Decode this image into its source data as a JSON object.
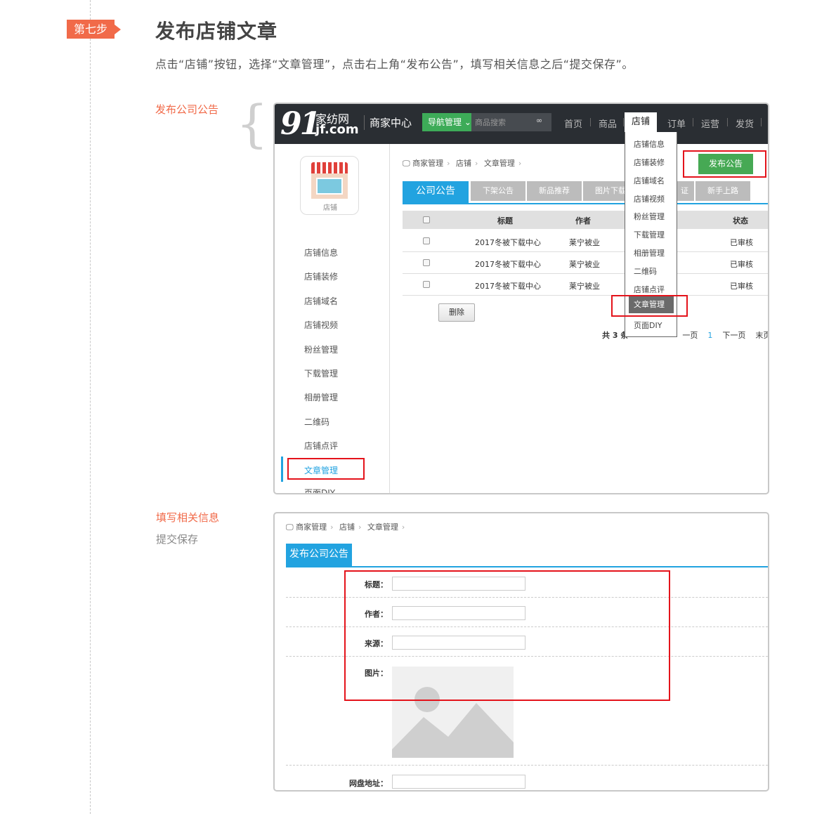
{
  "step": {
    "badge": "第七步",
    "title": "发布店铺文章",
    "instruction": "点击“店铺”按钮，选择“文章管理”，点击右上角“发布公告”，填写相关信息之后“提交保存”。"
  },
  "section1": {
    "label": "发布公司公告"
  },
  "section2": {
    "label": "填写相关信息",
    "sub_label": "提交保存"
  },
  "header": {
    "logo_num": "91",
    "logo_cn": "家纺网",
    "logo_en": "jf.com",
    "merchant_center": "商家中心",
    "nav_manage": "导航管理",
    "search_placeholder": "商品搜索",
    "nav": [
      "首页",
      "商品",
      "店铺",
      "订单",
      "运营",
      "发货"
    ]
  },
  "sidebar": {
    "shop_label": "店铺",
    "items": [
      "店铺信息",
      "店铺装修",
      "店铺域名",
      "店铺视频",
      "粉丝管理",
      "下载管理",
      "相册管理",
      "二维码",
      "店铺点评",
      "文章管理",
      "页面DIY"
    ]
  },
  "breadcrumb": [
    "商家管理",
    "店铺",
    "文章管理"
  ],
  "publish_button": "发布公告",
  "tabs": {
    "active": "公司公告",
    "others": [
      "下架公告",
      "新品推荐",
      "图片下载",
      "证",
      "新手上路"
    ]
  },
  "table": {
    "headers": [
      "标题",
      "作者",
      "状态"
    ],
    "rows": [
      {
        "title": "2017冬被下载中心",
        "author": "莱宁被业",
        "status": "已审核"
      },
      {
        "title": "2017冬被下载中心",
        "author": "莱宁被业",
        "status": "已审核"
      },
      {
        "title": "2017冬被下载中心",
        "author": "莱宁被业",
        "status": "已审核"
      }
    ]
  },
  "delete_button": "删除",
  "pager": {
    "summary": "共 3 条",
    "prev": "一页",
    "page": "1",
    "next": "下一页",
    "last": "末页",
    "total": "共"
  },
  "dropdown": [
    "店铺信息",
    "店铺装修",
    "店铺域名",
    "店铺视频",
    "粉丝管理",
    "下载管理",
    "相册管理",
    "二维码",
    "店铺点评",
    "文章管理",
    "页面DIY"
  ],
  "form": {
    "tab": "发布公司公告",
    "fields": {
      "title": "标题：",
      "author": "作者：",
      "source": "来源：",
      "image": "图片：",
      "netdisk": "网盘地址："
    }
  },
  "colors": {
    "accent": "#f16a49",
    "blue": "#22a3e0",
    "green": "#46a954",
    "highlight": "#e4131b"
  }
}
